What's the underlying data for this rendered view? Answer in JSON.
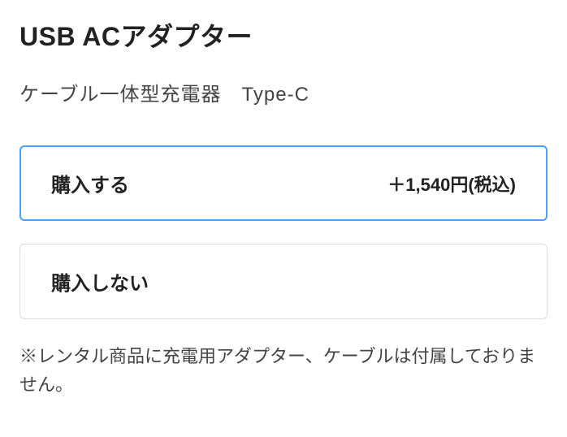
{
  "product": {
    "title": "USB ACアダプター",
    "subtitle": "ケーブル一体型充電器　Type-C"
  },
  "options": [
    {
      "label": "購入する",
      "price": "＋1,540円(税込)",
      "selected": true
    },
    {
      "label": "購入しない",
      "price": "",
      "selected": false
    }
  ],
  "note": "※レンタル商品に充電用アダプター、ケーブルは付属しておりません。"
}
